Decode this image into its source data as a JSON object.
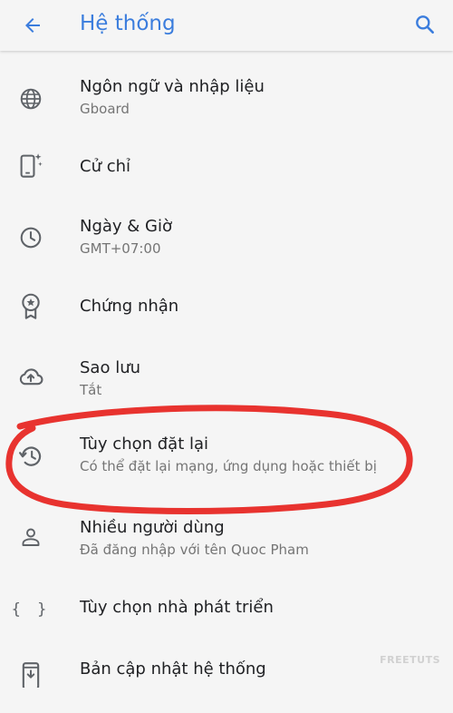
{
  "header": {
    "title": "Hệ thống",
    "back_icon": "arrow-back-icon",
    "search_icon": "search-icon",
    "accent_color": "#3b7ddd"
  },
  "items": [
    {
      "label": "Ngôn ngữ và nhập liệu",
      "sub": "Gboard",
      "icon": "globe-icon"
    },
    {
      "label": "Cử chỉ",
      "sub": "",
      "icon": "phone-gesture-icon"
    },
    {
      "label": "Ngày & Giờ",
      "sub": "GMT+07:00",
      "icon": "clock-icon"
    },
    {
      "label": "Chứng nhận",
      "sub": "",
      "icon": "certificate-icon"
    },
    {
      "label": "Sao lưu",
      "sub": "Tắt",
      "icon": "cloud-backup-icon"
    },
    {
      "label": "Tùy chọn đặt lại",
      "sub": "Có thể đặt lại mạng, ứng dụng hoặc thiết bị",
      "icon": "history-icon"
    },
    {
      "label": "Nhiều người dùng",
      "sub": "Đã đăng nhập với tên Quoc Pham",
      "icon": "person-icon"
    },
    {
      "label": "Tùy chọn nhà phát triển",
      "sub": "",
      "icon": "code-braces-icon"
    },
    {
      "label": "Bản cập nhật hệ thống",
      "sub": "",
      "icon": "system-update-icon"
    }
  ],
  "annotation_color": "#e8332f",
  "watermark": "FREETUTS"
}
